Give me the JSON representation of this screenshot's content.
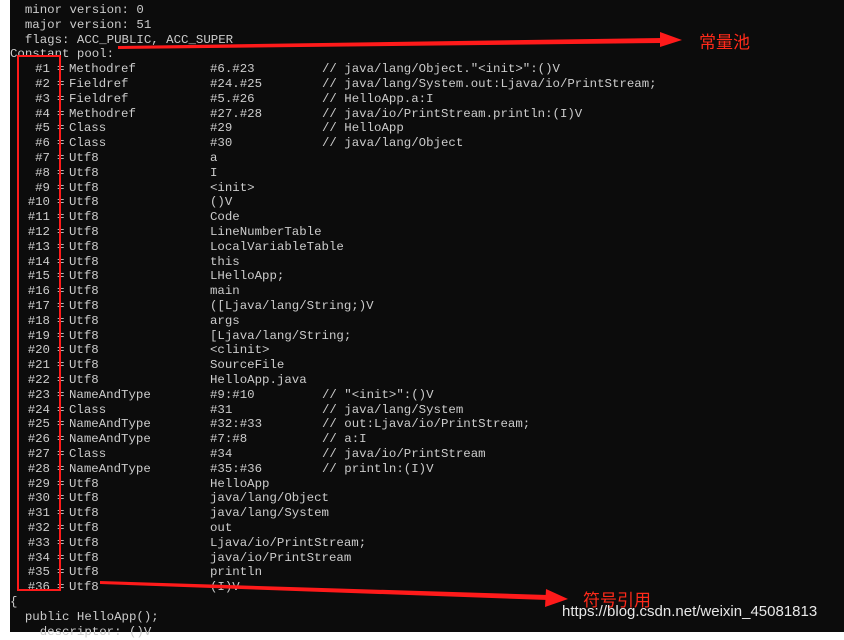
{
  "header_lines": [
    "  minor version: 0",
    "  major version: 51",
    "  flags: ACC_PUBLIC, ACC_SUPER",
    "Constant pool:"
  ],
  "constant_pool": [
    {
      "num": "#1",
      "type": "Methodref",
      "ref": "#6.#23",
      "comment": "// java/lang/Object.\"<init>\":()V"
    },
    {
      "num": "#2",
      "type": "Fieldref",
      "ref": "#24.#25",
      "comment": "// java/lang/System.out:Ljava/io/PrintStream;"
    },
    {
      "num": "#3",
      "type": "Fieldref",
      "ref": "#5.#26",
      "comment": "// HelloApp.a:I"
    },
    {
      "num": "#4",
      "type": "Methodref",
      "ref": "#27.#28",
      "comment": "// java/io/PrintStream.println:(I)V"
    },
    {
      "num": "#5",
      "type": "Class",
      "ref": "#29",
      "comment": "// HelloApp"
    },
    {
      "num": "#6",
      "type": "Class",
      "ref": "#30",
      "comment": "// java/lang/Object"
    },
    {
      "num": "#7",
      "type": "Utf8",
      "ref": "a",
      "comment": ""
    },
    {
      "num": "#8",
      "type": "Utf8",
      "ref": "I",
      "comment": ""
    },
    {
      "num": "#9",
      "type": "Utf8",
      "ref": "<init>",
      "comment": ""
    },
    {
      "num": "#10",
      "type": "Utf8",
      "ref": "()V",
      "comment": ""
    },
    {
      "num": "#11",
      "type": "Utf8",
      "ref": "Code",
      "comment": ""
    },
    {
      "num": "#12",
      "type": "Utf8",
      "ref": "LineNumberTable",
      "comment": ""
    },
    {
      "num": "#13",
      "type": "Utf8",
      "ref": "LocalVariableTable",
      "comment": ""
    },
    {
      "num": "#14",
      "type": "Utf8",
      "ref": "this",
      "comment": ""
    },
    {
      "num": "#15",
      "type": "Utf8",
      "ref": "LHelloApp;",
      "comment": ""
    },
    {
      "num": "#16",
      "type": "Utf8",
      "ref": "main",
      "comment": ""
    },
    {
      "num": "#17",
      "type": "Utf8",
      "ref": "([Ljava/lang/String;)V",
      "comment": ""
    },
    {
      "num": "#18",
      "type": "Utf8",
      "ref": "args",
      "comment": ""
    },
    {
      "num": "#19",
      "type": "Utf8",
      "ref": "[Ljava/lang/String;",
      "comment": ""
    },
    {
      "num": "#20",
      "type": "Utf8",
      "ref": "<clinit>",
      "comment": ""
    },
    {
      "num": "#21",
      "type": "Utf8",
      "ref": "SourceFile",
      "comment": ""
    },
    {
      "num": "#22",
      "type": "Utf8",
      "ref": "HelloApp.java",
      "comment": ""
    },
    {
      "num": "#23",
      "type": "NameAndType",
      "ref": "#9:#10",
      "comment": "// \"<init>\":()V"
    },
    {
      "num": "#24",
      "type": "Class",
      "ref": "#31",
      "comment": "// java/lang/System"
    },
    {
      "num": "#25",
      "type": "NameAndType",
      "ref": "#32:#33",
      "comment": "// out:Ljava/io/PrintStream;"
    },
    {
      "num": "#26",
      "type": "NameAndType",
      "ref": "#7:#8",
      "comment": "// a:I"
    },
    {
      "num": "#27",
      "type": "Class",
      "ref": "#34",
      "comment": "// java/io/PrintStream"
    },
    {
      "num": "#28",
      "type": "NameAndType",
      "ref": "#35:#36",
      "comment": "// println:(I)V"
    },
    {
      "num": "#29",
      "type": "Utf8",
      "ref": "HelloApp",
      "comment": ""
    },
    {
      "num": "#30",
      "type": "Utf8",
      "ref": "java/lang/Object",
      "comment": ""
    },
    {
      "num": "#31",
      "type": "Utf8",
      "ref": "java/lang/System",
      "comment": ""
    },
    {
      "num": "#32",
      "type": "Utf8",
      "ref": "out",
      "comment": ""
    },
    {
      "num": "#33",
      "type": "Utf8",
      "ref": "Ljava/io/PrintStream;",
      "comment": ""
    },
    {
      "num": "#34",
      "type": "Utf8",
      "ref": "java/io/PrintStream",
      "comment": ""
    },
    {
      "num": "#35",
      "type": "Utf8",
      "ref": "println",
      "comment": ""
    },
    {
      "num": "#36",
      "type": "Utf8",
      "ref": "(I)V",
      "comment": ""
    }
  ],
  "equals_sign": "=",
  "footer_lines": [
    "{",
    "  public HelloApp();",
    "    descriptor: ()V"
  ],
  "annotations": {
    "constant_pool_label": "常量池",
    "symbolic_ref_label": "符号引用",
    "color": "#ff1a1a"
  },
  "watermark": "https://blog.csdn.net/weixin_45081813"
}
